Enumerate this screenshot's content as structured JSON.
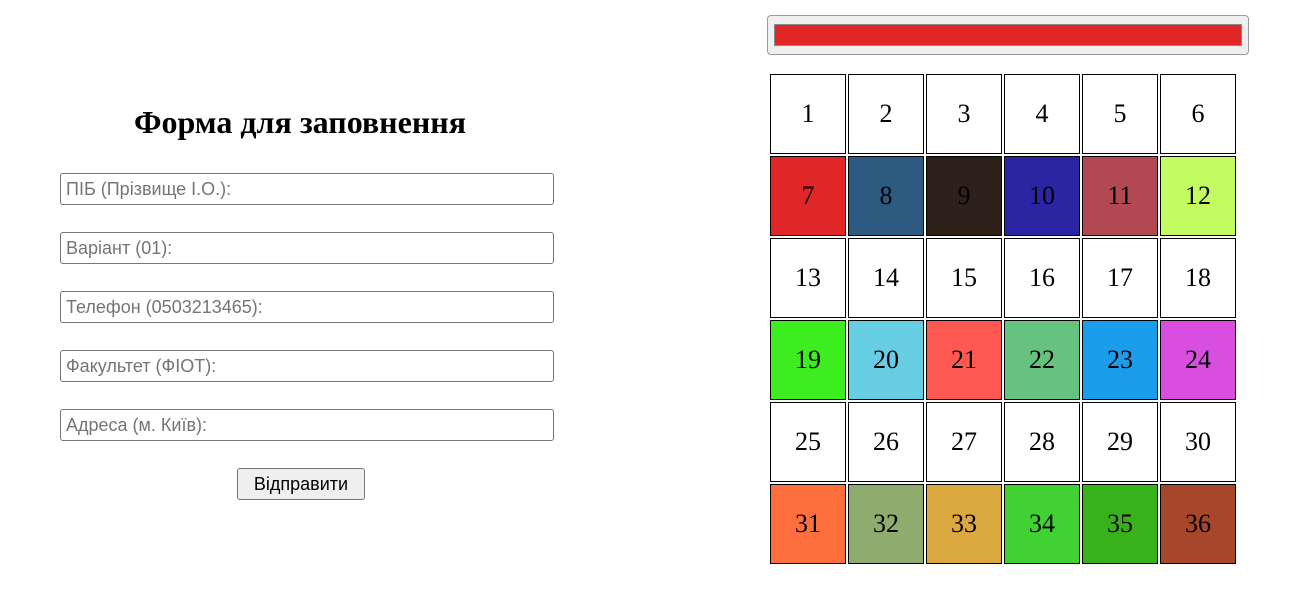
{
  "form": {
    "title": "Форма для заповнення",
    "fields": [
      {
        "placeholder": "ПІБ (Прізвище І.О.):",
        "value": ""
      },
      {
        "placeholder": "Варіант (01):",
        "value": ""
      },
      {
        "placeholder": "Телефон (0503213465):",
        "value": ""
      },
      {
        "placeholder": "Факультет (ФІОТ):",
        "value": ""
      },
      {
        "placeholder": "Адреса (м. Київ):",
        "value": ""
      }
    ],
    "submit_label": "Відправити"
  },
  "color_picker": {
    "value": "#e02626"
  },
  "grid": {
    "cells": [
      {
        "label": "1",
        "color": "#ffffff"
      },
      {
        "label": "2",
        "color": "#ffffff"
      },
      {
        "label": "3",
        "color": "#ffffff"
      },
      {
        "label": "4",
        "color": "#ffffff"
      },
      {
        "label": "5",
        "color": "#ffffff"
      },
      {
        "label": "6",
        "color": "#ffffff"
      },
      {
        "label": "7",
        "color": "#e02626"
      },
      {
        "label": "8",
        "color": "#2d5a80"
      },
      {
        "label": "9",
        "color": "#2e2119"
      },
      {
        "label": "10",
        "color": "#2b24a3"
      },
      {
        "label": "11",
        "color": "#b14852"
      },
      {
        "label": "12",
        "color": "#c2fc60"
      },
      {
        "label": "13",
        "color": "#ffffff"
      },
      {
        "label": "14",
        "color": "#ffffff"
      },
      {
        "label": "15",
        "color": "#ffffff"
      },
      {
        "label": "16",
        "color": "#ffffff"
      },
      {
        "label": "17",
        "color": "#ffffff"
      },
      {
        "label": "18",
        "color": "#ffffff"
      },
      {
        "label": "19",
        "color": "#3ded1f"
      },
      {
        "label": "20",
        "color": "#66cde3"
      },
      {
        "label": "21",
        "color": "#ff5853"
      },
      {
        "label": "22",
        "color": "#66c27f"
      },
      {
        "label": "23",
        "color": "#1b9deb"
      },
      {
        "label": "24",
        "color": "#d84fe0"
      },
      {
        "label": "25",
        "color": "#ffffff"
      },
      {
        "label": "26",
        "color": "#ffffff"
      },
      {
        "label": "27",
        "color": "#ffffff"
      },
      {
        "label": "28",
        "color": "#ffffff"
      },
      {
        "label": "29",
        "color": "#ffffff"
      },
      {
        "label": "30",
        "color": "#ffffff"
      },
      {
        "label": "31",
        "color": "#ff6f3d"
      },
      {
        "label": "32",
        "color": "#8fab6d"
      },
      {
        "label": "33",
        "color": "#dca840"
      },
      {
        "label": "34",
        "color": "#40d132"
      },
      {
        "label": "35",
        "color": "#38b21a"
      },
      {
        "label": "36",
        "color": "#a6472b"
      }
    ]
  }
}
